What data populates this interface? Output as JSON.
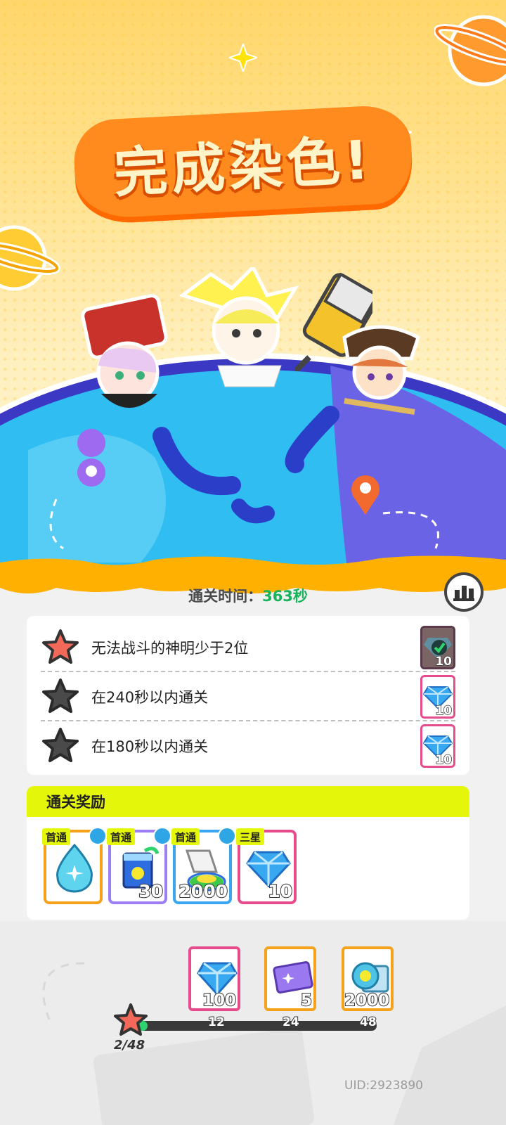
{
  "title": "完成染色!",
  "clear_time": {
    "label": "通关时间：",
    "value": "363秒"
  },
  "objectives": [
    {
      "text": "无法战斗的神明少于2位",
      "achieved": true,
      "reward_icon": "diamond-check-icon",
      "reward_count": "10"
    },
    {
      "text": "在240秒以内通关",
      "achieved": false,
      "reward_icon": "diamond-icon",
      "reward_count": "10"
    },
    {
      "text": "在180秒以内通关",
      "achieved": false,
      "reward_icon": "diamond-icon",
      "reward_count": "10"
    }
  ],
  "rewards": {
    "title": "通关奖励",
    "items": [
      {
        "tag": "首通",
        "icon": "water-drop-icon",
        "qty": "",
        "border": "#f4a11b"
      },
      {
        "tag": "首通",
        "icon": "paint-can-icon",
        "qty": "30",
        "border": "#9d7df2"
      },
      {
        "tag": "首通",
        "icon": "paint-tube-icon",
        "qty": "2000",
        "border": "#3aa5f0"
      },
      {
        "tag": "三星",
        "icon": "diamond-icon",
        "qty": "10",
        "border": "#e64c8c"
      }
    ]
  },
  "progress": {
    "current_text": "2/48",
    "current": 2,
    "max": 48,
    "milestones": [
      {
        "value": "12",
        "reward_icon": "diamond-icon",
        "reward_qty": "100",
        "border": "#e64c8c"
      },
      {
        "value": "24",
        "reward_icon": "purple-ticket-icon",
        "reward_qty": "5",
        "border": "#f4a11b"
      },
      {
        "value": "48",
        "reward_icon": "coin-ticket-icon",
        "reward_qty": "2000",
        "border": "#f4a11b"
      }
    ]
  },
  "uid": "UID:2923890",
  "colors": {
    "accent_yellow": "#e4f60a",
    "time_green": "#18b35a",
    "progress_green": "#2fd36b"
  }
}
